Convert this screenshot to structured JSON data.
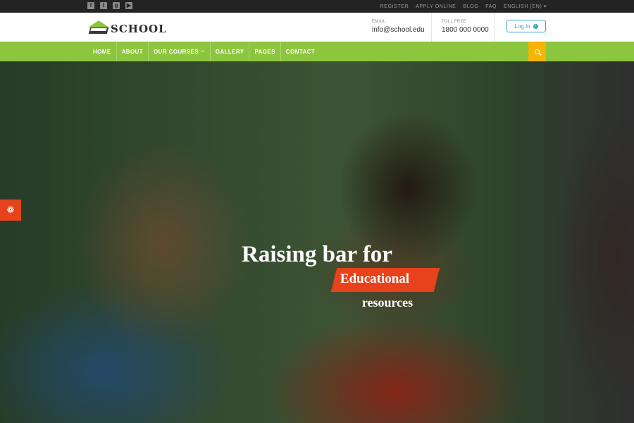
{
  "topbar": {
    "social": [
      {
        "icon": "facebook-icon",
        "glyph": "f"
      },
      {
        "icon": "twitter-icon",
        "glyph": "t"
      },
      {
        "icon": "google-plus-icon",
        "glyph": "g"
      },
      {
        "icon": "youtube-icon",
        "glyph": "▶"
      }
    ],
    "links": [
      "REGISTER",
      "APPLY ONLINE",
      "BLOG",
      "FAQ"
    ],
    "language": "ENGLISH (EN)"
  },
  "header": {
    "logo_text": "SCHOOL",
    "email_label": "EMAIL",
    "email_value": "info@school.edu",
    "toll_label": "TOLL FREE",
    "toll_value": "1800 000 0000",
    "login_label": "Log In"
  },
  "nav": {
    "items": [
      "HOME",
      "ABOUT",
      "OUR COURSES",
      "GALLERY",
      "PAGES",
      "CONTACT"
    ]
  },
  "hero": {
    "title": "Raising bar for",
    "highlight": "Educational",
    "subtitle": "resources"
  },
  "colors": {
    "accent_green": "#8cc63f",
    "accent_orange": "#e8421c",
    "search_yellow": "#f5b400",
    "login_blue": "#3aa3c8"
  }
}
